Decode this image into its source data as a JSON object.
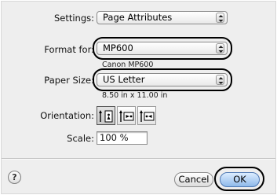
{
  "settings": {
    "label": "Settings:",
    "value": "Page Attributes"
  },
  "format_for": {
    "label": "Format for:",
    "value": "MP600",
    "description": "Canon MP600"
  },
  "paper_size": {
    "label": "Paper Size:",
    "value": "US Letter",
    "dimensions": "8.50 in x 11.00 in"
  },
  "orientation": {
    "label": "Orientation:",
    "options": [
      {
        "name": "portrait",
        "icon": "portrait-orientation-icon",
        "selected": true
      },
      {
        "name": "landscape-left",
        "icon": "landscape-left-orientation-icon",
        "selected": false
      },
      {
        "name": "landscape-right",
        "icon": "landscape-right-orientation-icon",
        "selected": false
      }
    ]
  },
  "scale": {
    "label": "Scale:",
    "value": "100 %"
  },
  "buttons": {
    "help": "?",
    "cancel": "Cancel",
    "ok": "OK"
  },
  "colors": {
    "default_button": "#8fb9ea",
    "panel": "#eeeeee"
  }
}
